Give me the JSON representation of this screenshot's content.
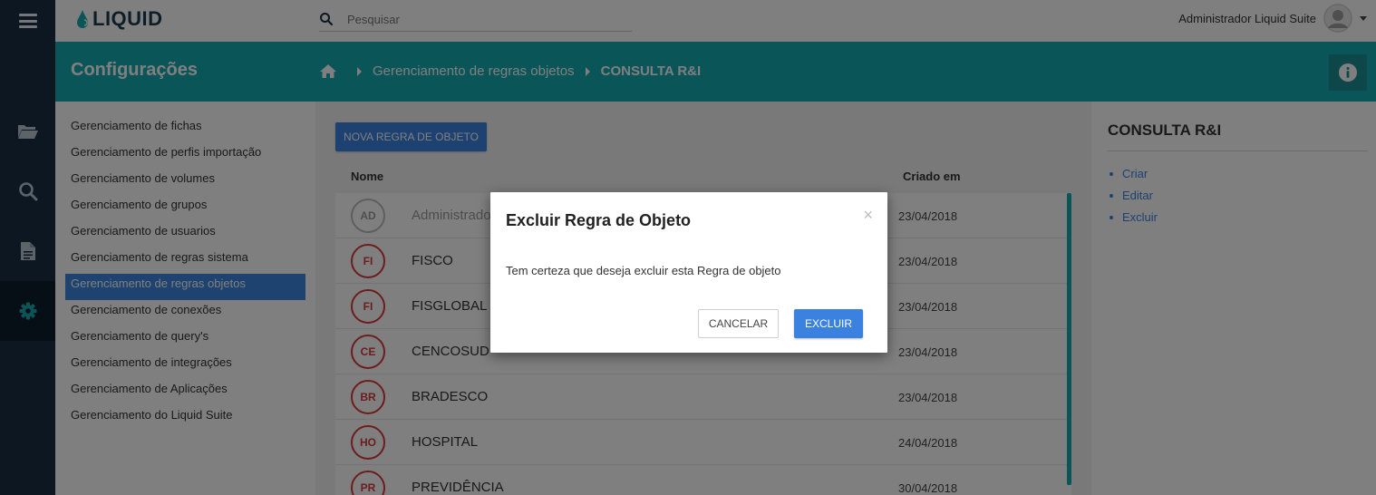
{
  "app": {
    "logo_text": "LIQUID"
  },
  "search": {
    "placeholder": "Pesquisar"
  },
  "user": {
    "name": "Administrador Liquid Suite"
  },
  "header": {
    "title": "Configurações",
    "breadcrumb": [
      "Gerenciamento de regras objetos",
      "CONSULTA R&I"
    ]
  },
  "rail": [
    "folder-icon",
    "search-icon",
    "document-icon",
    "gear-icon"
  ],
  "settings": {
    "items": [
      "Gerenciamento de fichas",
      "Gerenciamento de perfis importação",
      "Gerenciamento de volumes",
      "Gerenciamento de grupos",
      "Gerenciamento de usuarios",
      "Gerenciamento de regras sistema",
      "Gerenciamento de regras objetos",
      "Gerenciamento de conexões",
      "Gerenciamento de query's",
      "Gerenciamento de integrações",
      "Gerenciamento de Aplicações",
      "Gerenciamento do Liquid Suite"
    ],
    "active_index": 6
  },
  "main": {
    "new_button": "NOVA REGRA DE OBJETO",
    "columns": {
      "name": "Nome",
      "created": "Criado em"
    },
    "rows": [
      {
        "initials": "AD",
        "name": "Administrador",
        "date": "23/04/2018",
        "muted": true
      },
      {
        "initials": "FI",
        "name": "FISCO",
        "date": "23/04/2018"
      },
      {
        "initials": "FI",
        "name": "FISGLOBAL",
        "date": "23/04/2018"
      },
      {
        "initials": "CE",
        "name": "CENCOSUD",
        "date": "23/04/2018"
      },
      {
        "initials": "BR",
        "name": "BRADESCO",
        "date": "23/04/2018"
      },
      {
        "initials": "HO",
        "name": "HOSPITAL",
        "date": "24/04/2018"
      },
      {
        "initials": "PR",
        "name": "PREVIDÊNCIA",
        "date": "30/04/2018"
      }
    ]
  },
  "right_panel": {
    "title": "CONSULTA R&I",
    "actions": [
      "Criar",
      "Editar",
      "Excluir"
    ]
  },
  "modal": {
    "title": "Excluir Regra de Objeto",
    "close": "×",
    "message": "Tem certeza que deseja excluir esta Regra de objeto",
    "cancel_label": "CANCELAR",
    "confirm_label": "EXCLUIR"
  },
  "colors": {
    "teal": "#15aab0",
    "navy": "#1a2f45",
    "primary_blue": "#3b82e0",
    "badge_red": "#d83a3a"
  }
}
